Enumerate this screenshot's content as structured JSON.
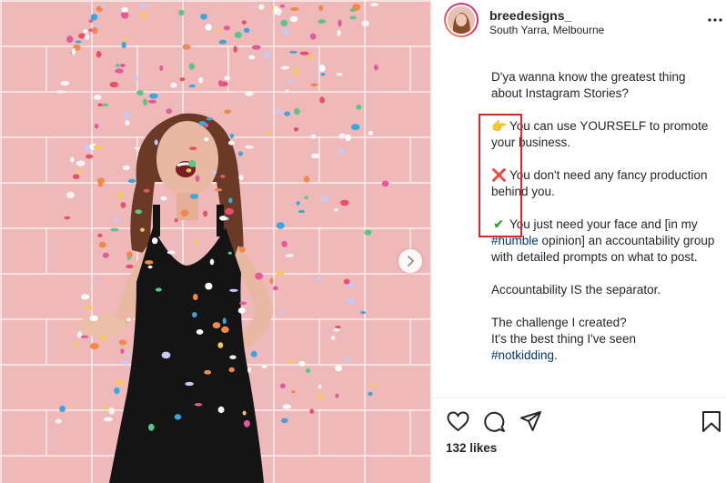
{
  "post": {
    "username": "breedesigns_",
    "location": "South Yarra, Melbourne",
    "likes": "132 likes"
  },
  "caption": {
    "line1": "D'ya wanna know the greatest thing about Instagram Stories?",
    "point1_emoji": "👉",
    "point1": "You can use YOURSELF to promote your business.",
    "point2_emoji": "❌",
    "point2": "You don't need any fancy production behind you.",
    "point3_emoji": "✔",
    "point3_before": "You just need your face and [in my ",
    "point3_hashtag": "#humble",
    "point3_after": " opinion] an accountability group with detailed prompts on what to post.",
    "line_accountability": "Accountability IS the separator.",
    "challenge_q": "The challenge I created?",
    "challenge_a": "It's the best thing I've seen",
    "closing_hashtag": "#notkidding."
  },
  "icons": {
    "like": "heart-icon",
    "comment": "comment-icon",
    "share": "paper-plane-icon",
    "save": "bookmark-icon",
    "more": "more-icon",
    "next": "chevron-right-icon"
  },
  "colors": {
    "text": "#262626",
    "hashtag": "#00376b",
    "highlight": "#d9262a",
    "wall": "#efb9ba"
  }
}
